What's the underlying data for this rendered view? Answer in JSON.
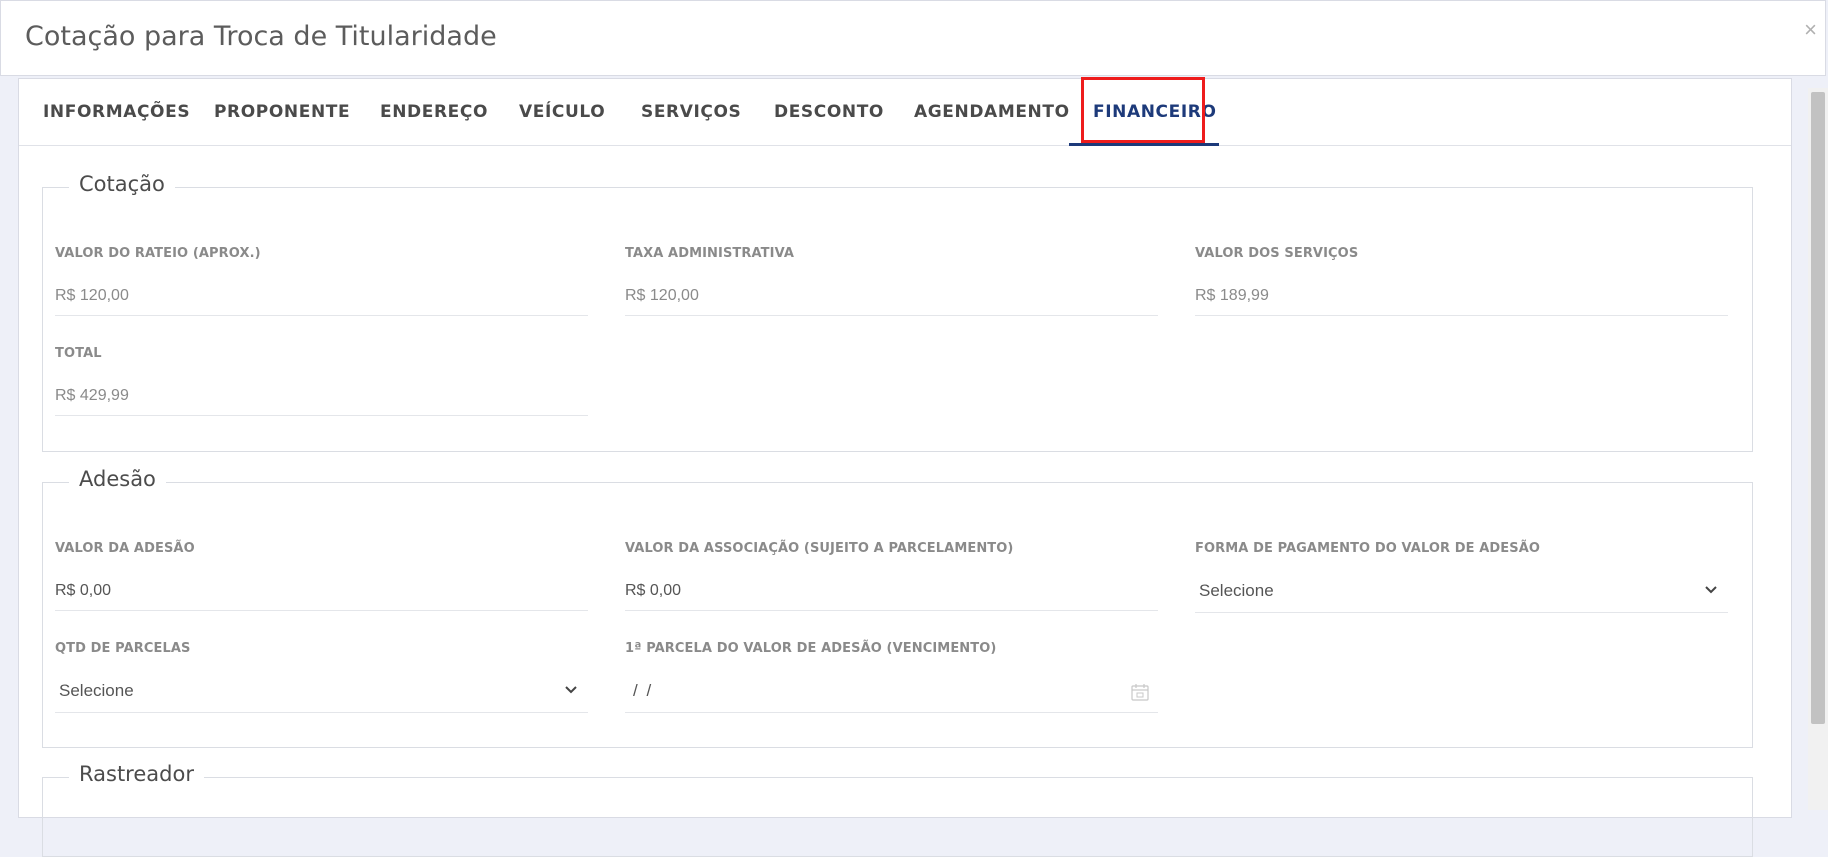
{
  "modal": {
    "title": "Cotação para Troca de Titularidade",
    "close_label": "×"
  },
  "tabs": [
    {
      "label": "INFORMAÇÕES",
      "active": false
    },
    {
      "label": "PROPONENTE",
      "active": false
    },
    {
      "label": "ENDEREÇO",
      "active": false
    },
    {
      "label": "VEÍCULO",
      "active": false
    },
    {
      "label": "SERVIÇOS",
      "active": false
    },
    {
      "label": "DESCONTO",
      "active": false
    },
    {
      "label": "AGENDAMENTO",
      "active": false
    },
    {
      "label": "FINANCEIRO",
      "active": true
    }
  ],
  "cotacao": {
    "legend": "Cotação",
    "valor_rateio": {
      "label": "VALOR DO RATEIO (APROX.)",
      "value": "R$ 120,00"
    },
    "taxa_admin": {
      "label": "TAXA ADMINISTRATIVA",
      "value": "R$ 120,00"
    },
    "valor_servicos": {
      "label": "VALOR DOS SERVIÇOS",
      "value": "R$ 189,99"
    },
    "total": {
      "label": "TOTAL",
      "value": "R$ 429,99"
    }
  },
  "adesao": {
    "legend": "Adesão",
    "valor_adesao": {
      "label": "VALOR DA ADESÃO",
      "value": "R$ 0,00"
    },
    "valor_associacao": {
      "label": "VALOR DA ASSOCIAÇÃO (SUJEITO A PARCELAMENTO)",
      "value": "R$ 0,00"
    },
    "forma_pagamento": {
      "label": "FORMA DE PAGAMENTO DO VALOR DE ADESÃO",
      "value": "Selecione"
    },
    "qtd_parcelas": {
      "label": "QTD DE PARCELAS",
      "value": "Selecione"
    },
    "primeira_parcela": {
      "label": "1ª PARCELA DO VALOR DE ADESÃO (VENCIMENTO)",
      "value": "/ /"
    }
  },
  "rastreador": {
    "legend": "Rastreador"
  },
  "colors": {
    "active_tab": "#1d3a7a",
    "highlight": "#ee1c1c",
    "label": "#8a8a8a"
  }
}
